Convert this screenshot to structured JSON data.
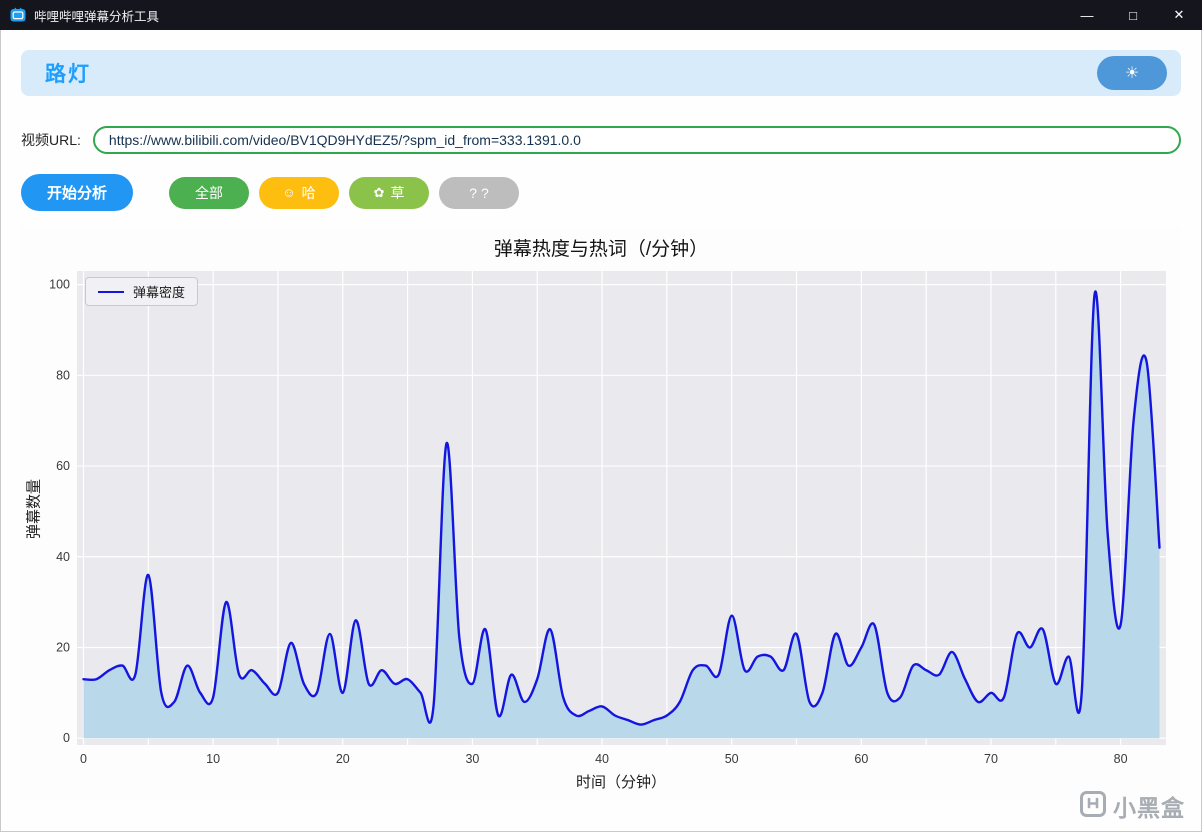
{
  "titlebar": {
    "title": "哔哩哔哩弹幕分析工具",
    "minimize_glyph": "—",
    "maximize_glyph": "□",
    "close_glyph": "✕"
  },
  "header": {
    "brand": "路灯",
    "theme_icon": "☀"
  },
  "url_row": {
    "label": "视频URL:",
    "value": "https://www.bilibili.com/video/BV1QD9HYdEZ5/?spm_id_from=333.1391.0.0"
  },
  "toolbar": {
    "analyze_label": "开始分析",
    "filters": [
      {
        "label": "全部",
        "color": "#4caf50"
      },
      {
        "icon": "☺",
        "label": "哈",
        "color": "#fdbe10"
      },
      {
        "icon": "✿",
        "label": "草",
        "color": "#8bc34a"
      },
      {
        "label": "? ?",
        "color": "#bdbdbd"
      }
    ]
  },
  "chart_data": {
    "type": "area",
    "title": "弹幕热度与热词（/分钟）",
    "xlabel": "时间（分钟）",
    "ylabel": "弹幕数量",
    "legend": [
      "弹幕密度"
    ],
    "grid": true,
    "legend_position": "upper left",
    "x": [
      0,
      1,
      2,
      3,
      4,
      5,
      6,
      7,
      8,
      9,
      10,
      11,
      12,
      13,
      14,
      15,
      16,
      17,
      18,
      19,
      20,
      21,
      22,
      23,
      24,
      25,
      26,
      27,
      28,
      29,
      30,
      31,
      32,
      33,
      34,
      35,
      36,
      37,
      38,
      39,
      40,
      41,
      42,
      43,
      44,
      45,
      46,
      47,
      48,
      49,
      50,
      51,
      52,
      53,
      54,
      55,
      56,
      57,
      58,
      59,
      60,
      61,
      62,
      63,
      64,
      65,
      66,
      67,
      68,
      69,
      70,
      71,
      72,
      73,
      74,
      75,
      76,
      77,
      78,
      79,
      80,
      81,
      82,
      83
    ],
    "series": [
      {
        "name": "弹幕密度",
        "values": [
          13,
          13,
          15,
          16,
          14,
          36,
          10,
          8,
          16,
          10,
          9,
          30,
          14,
          15,
          12,
          10,
          21,
          12,
          10,
          23,
          10,
          26,
          12,
          15,
          12,
          13,
          10,
          7,
          65,
          22,
          12,
          24,
          5,
          14,
          8,
          13,
          24,
          9,
          5,
          6,
          7,
          5,
          4,
          3,
          4,
          5,
          8,
          15,
          16,
          14,
          27,
          15,
          18,
          18,
          15,
          23,
          8,
          10,
          23,
          16,
          20,
          25,
          10,
          9,
          16,
          15,
          14,
          19,
          13,
          8,
          10,
          9,
          23,
          20,
          24,
          12,
          18,
          10,
          98,
          45,
          25,
          70,
          83,
          42
        ]
      }
    ],
    "x_ticks": [
      0,
      10,
      20,
      30,
      40,
      50,
      60,
      70,
      80
    ],
    "y_ticks": [
      0,
      20,
      40,
      60,
      80,
      100
    ],
    "x_grid_step": 5,
    "xlim": [
      -0.5,
      83.5
    ],
    "ylim": [
      -1.5,
      103
    ],
    "colors": {
      "line": "#1515e0",
      "fill": "#b9d9ea",
      "plot_bg": "#e9e9ee",
      "grid": "#ffffff"
    }
  },
  "watermark": {
    "text": "小黑盒"
  }
}
